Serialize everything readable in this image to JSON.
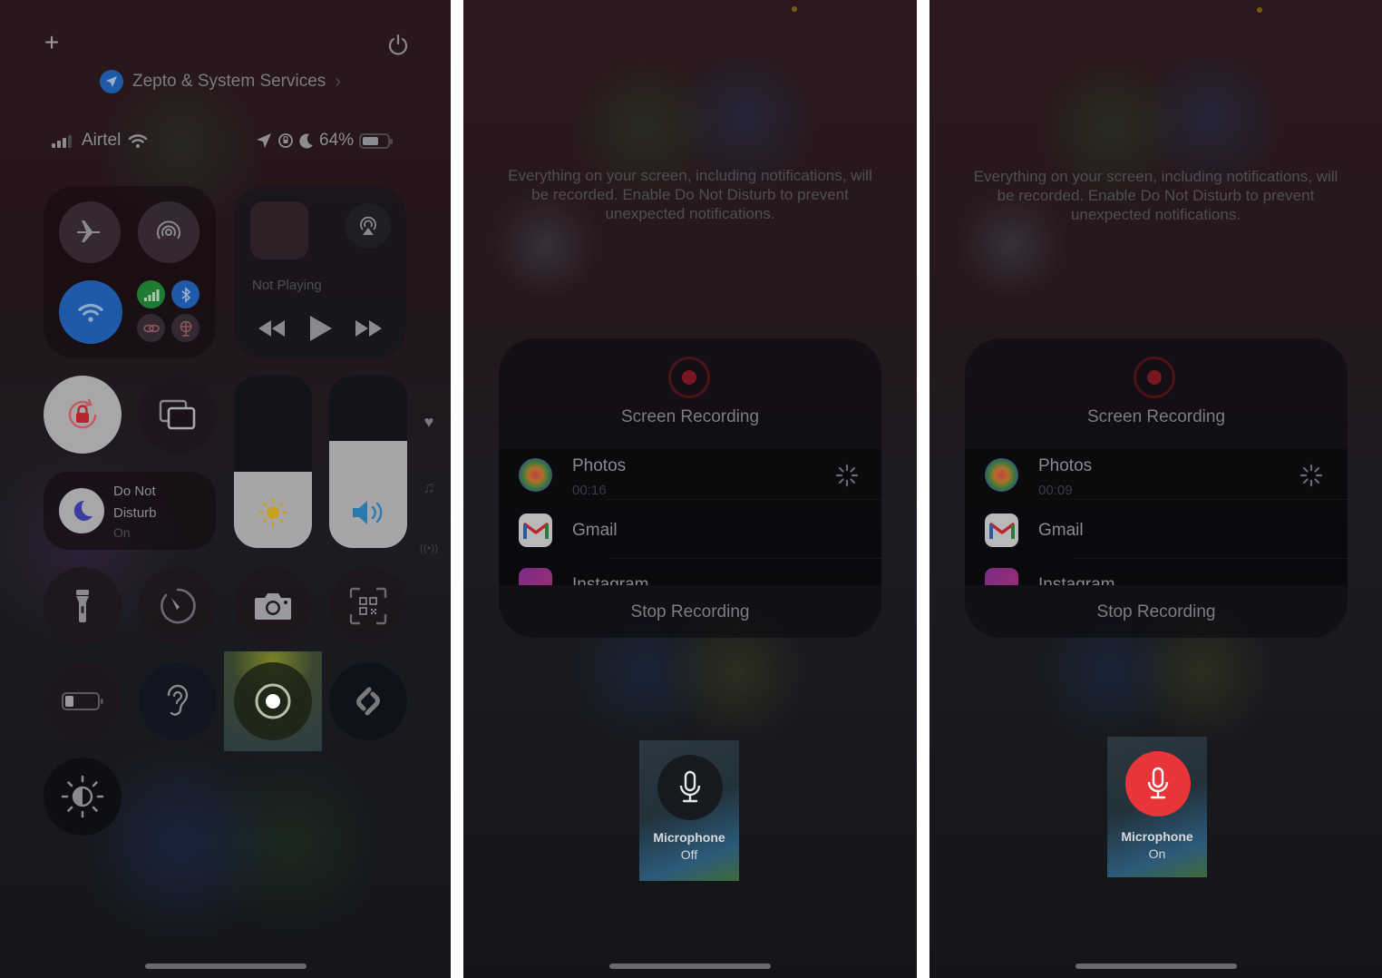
{
  "panel1": {
    "location_label": "Zepto & System Services",
    "carrier": "Airtel",
    "battery_percent": "64%",
    "battery_level": 0.64,
    "media": {
      "status": "Not Playing"
    },
    "brightness_level": 0.44,
    "volume_level": 0.62,
    "do_not_disturb": {
      "line1": "Do Not",
      "line2": "Disturb",
      "state": "On"
    },
    "icons": {
      "add": "plus-icon",
      "power": "power-icon",
      "airplane": "airplane-icon",
      "airdrop": "airdrop-icon",
      "wifi": "wifi-icon",
      "cellular": "cellular-icon",
      "bluetooth": "bluetooth-icon",
      "link": "link-icon",
      "hotspot": "hotspot-icon",
      "airplay": "airplay-icon",
      "rotation_lock": "rotation-lock-icon",
      "screen_mirroring": "screen-mirroring-icon",
      "flashlight": "flashlight-icon",
      "timer": "timer-icon",
      "camera": "camera-icon",
      "qr_scanner": "qr-code-icon",
      "low_power": "battery-icon",
      "hearing": "ear-icon",
      "screen_record": "screen-record-icon",
      "shazam": "shazam-icon",
      "dark_mode": "dark-mode-icon"
    },
    "colors": {
      "wifi_active": "#1f5aa8",
      "cellular_active": "#1f7a32",
      "bluetooth_active": "#1f5aa8"
    }
  },
  "panel2": {
    "warning": "Everything on your screen, including notifications, will be recorded. Enable Do Not Disturb to prevent unexpected notifications.",
    "title": "Screen Recording",
    "apps": [
      {
        "name": "Photos",
        "time": "00:16"
      },
      {
        "name": "Gmail"
      },
      {
        "name": "Instagram"
      }
    ],
    "stop_label": "Stop Recording",
    "microphone": {
      "label": "Microphone",
      "state": "Off"
    }
  },
  "panel3": {
    "warning": "Everything on your screen, including notifications, will be recorded. Enable Do Not Disturb to prevent unexpected notifications.",
    "title": "Screen Recording",
    "apps": [
      {
        "name": "Photos",
        "time": "00:09"
      },
      {
        "name": "Gmail"
      },
      {
        "name": "Instagram"
      }
    ],
    "stop_label": "Stop Recording",
    "microphone": {
      "label": "Microphone",
      "state": "On"
    },
    "colors": {
      "mic_on": "#e8353a"
    }
  }
}
